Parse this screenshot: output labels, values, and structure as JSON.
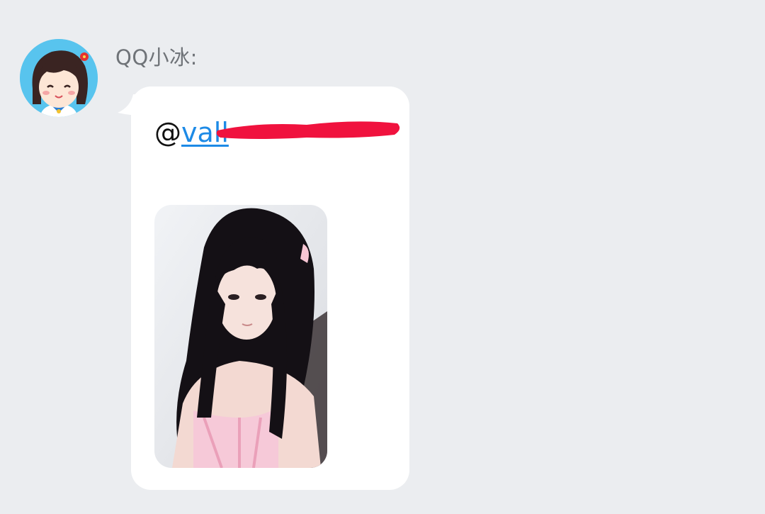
{
  "message": {
    "sender_name": "QQ小冰:",
    "mention_prefix": "@",
    "mention_text": "vall",
    "avatar_icon": "cartoon-girl-avatar",
    "image_description_icon": "photo-thumbnail",
    "redaction_color": "#f0123e"
  },
  "colors": {
    "background": "#ebedf0",
    "bubble": "#ffffff",
    "link": "#1d8ae6",
    "avatar_bg": "#58c4ee"
  }
}
